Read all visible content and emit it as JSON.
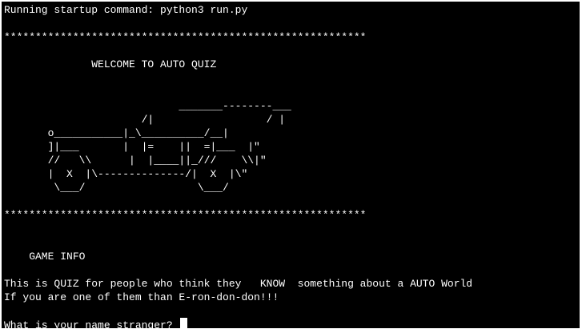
{
  "terminal": {
    "lines": [
      "Running startup command: python3 run.py",
      "",
      "**********************************************************",
      "",
      "              WELCOME TO AUTO QUIZ",
      "",
      "",
      "                            _______--------___",
      "                      /|                  / |",
      "       o___________|_\\__________/__|",
      "       ]|___       |  |=    ||  =|___  |\"",
      "       //   \\\\      |  |____||_///    \\\\|\"",
      "       |  X  |\\--------------/|  X  |\\\"",
      "        \\___/                  \\___/",
      "",
      "**********************************************************",
      "",
      "",
      "    GAME INFO",
      "",
      "This is QUIZ for people who think they   KNOW  something about a AUTO World",
      "If you are one of them than E-ron-don-don!!!",
      "",
      "What is your name stranger? "
    ],
    "prompt_value": ""
  }
}
